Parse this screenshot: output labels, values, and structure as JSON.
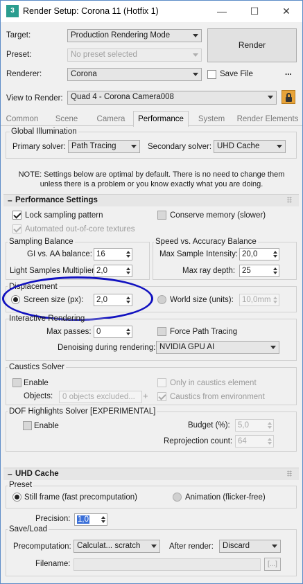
{
  "window": {
    "title": "Render Setup: Corona 11 (Hotfix 1)",
    "icon_label": "3",
    "minimize_icon": "—",
    "maximize_icon": "☐",
    "close_icon": "✕"
  },
  "top": {
    "target_label": "Target:",
    "target_value": "Production Rendering Mode",
    "preset_label": "Preset:",
    "preset_value": "No preset selected",
    "renderer_label": "Renderer:",
    "renderer_value": "Corona",
    "save_file_label": "Save File",
    "more_label": "...",
    "view_label": "View to Render:",
    "view_value": "Quad 4 - Corona Camera008",
    "render_button": "Render"
  },
  "tabs": [
    "Common",
    "Scene",
    "Camera",
    "Performance",
    "System",
    "Render Elements"
  ],
  "gi": {
    "group_title": "Global Illumination",
    "primary_label": "Primary solver:",
    "primary_value": "Path Tracing",
    "secondary_label": "Secondary solver:",
    "secondary_value": "UHD Cache",
    "note_line1": "NOTE: Settings below are optimal by default. There is no need to change them",
    "note_line2": "unless there is a problem or you know exactly what you are doing."
  },
  "perf": {
    "title": "Performance Settings",
    "lock_sampling": "Lock sampling pattern",
    "conserve_memory": "Conserve memory (slower)",
    "auto_ooc": "Automated out-of-core textures",
    "sampling_balance": {
      "title": "Sampling Balance",
      "gi_aa_label": "GI vs. AA balance:",
      "gi_aa_value": "16",
      "light_label": "Light Samples Multiplier:",
      "light_value": "2,0"
    },
    "speed_accuracy": {
      "title": "Speed vs. Accuracy Balance",
      "max_sample_label": "Max Sample Intensity:",
      "max_sample_value": "20,0",
      "max_ray_label": "Max ray depth:",
      "max_ray_value": "25"
    },
    "displacement": {
      "title": "Displacement",
      "screen_size_label": "Screen size (px):",
      "screen_size_value": "2,0",
      "world_size_label": "World size (units):",
      "world_size_value": "10,0mm"
    },
    "interactive": {
      "title": "Interactive Rendering",
      "max_passes_label": "Max passes:",
      "max_passes_value": "0",
      "force_path_tracing": "Force Path Tracing",
      "denoise_label": "Denoising during rendering:",
      "denoise_value": "NVIDIA GPU AI"
    },
    "caustics": {
      "title": "Caustics Solver",
      "enable": "Enable",
      "only_in_caustics": "Only in caustics element",
      "objects_label": "Objects:",
      "objects_value": "0 objects excluded...",
      "plus": "+",
      "from_env": "Caustics from environment"
    },
    "dof": {
      "title": "DOF Highlights Solver [EXPERIMENTAL]",
      "enable": "Enable",
      "budget_label": "Budget (%):",
      "budget_value": "5,0",
      "reproj_label": "Reprojection count:",
      "reproj_value": "64"
    }
  },
  "uhd": {
    "title": "UHD Cache",
    "preset_title": "Preset",
    "still_frame": "Still frame (fast precomputation)",
    "animation": "Animation (flicker-free)",
    "precision_label": "Precision:",
    "precision_value": "1,0",
    "saveload_title": "Save/Load",
    "precomp_label": "Precomputation:",
    "precomp_value": "Calculat... scratch",
    "after_render_label": "After render:",
    "after_render_value": "Discard",
    "filename_label": "Filename:",
    "browse": "[...]"
  }
}
